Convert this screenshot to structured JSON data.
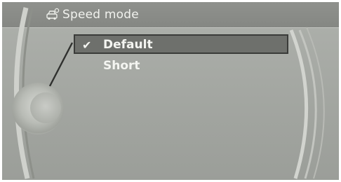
{
  "header": {
    "title": "Speed mode",
    "icon": "car-settings-icon"
  },
  "menu": {
    "items": [
      {
        "label": "Default",
        "selected": true,
        "check_icon": "checkmark-icon",
        "check_glyph": "✔"
      },
      {
        "label": "Short",
        "selected": false
      }
    ]
  },
  "colors": {
    "background": "#a6a9a4",
    "title_bar": "#8a8c88",
    "highlight": "#6e706c",
    "text": "#f4f5f1"
  }
}
